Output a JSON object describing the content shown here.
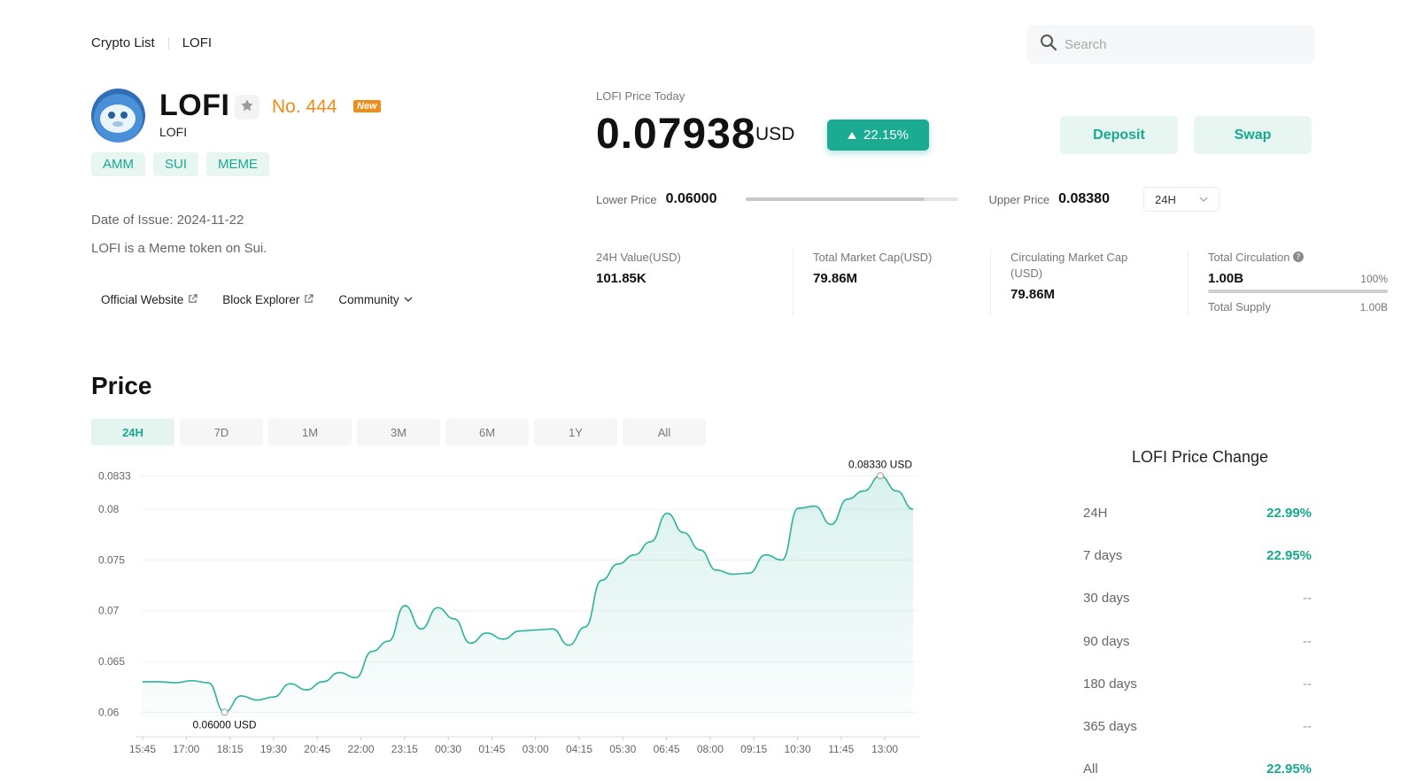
{
  "breadcrumb": {
    "root": "Crypto List",
    "current": "LOFI"
  },
  "search": {
    "placeholder": "Search"
  },
  "coin": {
    "name": "LOFI",
    "symbol": "LOFI",
    "rank": "No. 444",
    "badge": "New",
    "tags": [
      "AMM",
      "SUI",
      "MEME"
    ],
    "issue_date": "Date of Issue: 2024-11-22",
    "description": "LOFI is a Meme token on Sui.",
    "links": {
      "website": "Official Website",
      "explorer": "Block Explorer",
      "community": "Community"
    }
  },
  "price_today": {
    "label": "LOFI Price Today",
    "price": "0.07938",
    "unit": "USD",
    "change": "22.15%",
    "deposit_label": "Deposit",
    "swap_label": "Swap",
    "lower_label": "Lower Price",
    "lower_value": "0.06000",
    "upper_label": "Upper Price",
    "upper_value": "0.08380",
    "range_fraction": 0.84,
    "period": "24H"
  },
  "stats": {
    "value_24h_label": "24H Value(USD)",
    "value_24h": "101.85K",
    "mcap_label": "Total Market Cap(USD)",
    "mcap": "79.86M",
    "circ_mcap_label_1": "Circulating Market Cap",
    "circ_mcap_label_2": "(USD)",
    "circ_mcap": "79.86M",
    "circulation_label": "Total Circulation",
    "circulation": "1.00B",
    "circulation_pct": "100%",
    "circulation_fraction": 1.0,
    "supply_label": "Total Supply",
    "supply": "1.00B"
  },
  "price_section": {
    "title": "Price",
    "ranges": [
      "24H",
      "7D",
      "1M",
      "3M",
      "6M",
      "1Y",
      "All"
    ],
    "active_range": "24H"
  },
  "chart_data": {
    "type": "area",
    "title": "",
    "xlabel": "",
    "ylabel": "",
    "x_ticks": [
      "15:45",
      "17:00",
      "18:15",
      "19:30",
      "20:45",
      "22:00",
      "23:15",
      "00:30",
      "01:45",
      "03:00",
      "04:15",
      "05:30",
      "06:45",
      "08:00",
      "09:15",
      "10:30",
      "11:45",
      "13:00"
    ],
    "y_ticks": [
      "0.0833",
      "0.08",
      "0.075",
      "0.07",
      "0.065",
      "0.06"
    ],
    "ylim": [
      0.0595,
      0.0835
    ],
    "series": [
      {
        "values": [
          0.063,
          0.063,
          0.0629,
          0.0631,
          0.0629,
          0.06,
          0.0616,
          0.0612,
          0.0615,
          0.0628,
          0.0622,
          0.063,
          0.0639,
          0.0634,
          0.066,
          0.067,
          0.0705,
          0.0682,
          0.0703,
          0.0692,
          0.0668,
          0.0678,
          0.0672,
          0.068,
          0.0681,
          0.0682,
          0.0666,
          0.0684,
          0.073,
          0.0746,
          0.0755,
          0.0768,
          0.0796,
          0.0777,
          0.076,
          0.074,
          0.0736,
          0.0737,
          0.0755,
          0.075,
          0.0801,
          0.0803,
          0.0785,
          0.081,
          0.0818,
          0.0833,
          0.0818,
          0.08
        ],
        "color": "#2bb39b"
      }
    ],
    "max_label": "0.08330  USD",
    "min_label": "0.06000  USD"
  },
  "price_change": {
    "title": "LOFI Price Change",
    "rows": [
      {
        "label": "24H",
        "value": "22.99%"
      },
      {
        "label": "7 days",
        "value": "22.95%"
      },
      {
        "label": "30 days",
        "value": "--"
      },
      {
        "label": "90 days",
        "value": "--"
      },
      {
        "label": "180 days",
        "value": "--"
      },
      {
        "label": "365 days",
        "value": "--"
      },
      {
        "label": "All",
        "value": "22.95%"
      }
    ]
  },
  "colors": {
    "accent": "#17a98e",
    "rank": "#f08c1a",
    "pill": "#1aab92"
  }
}
